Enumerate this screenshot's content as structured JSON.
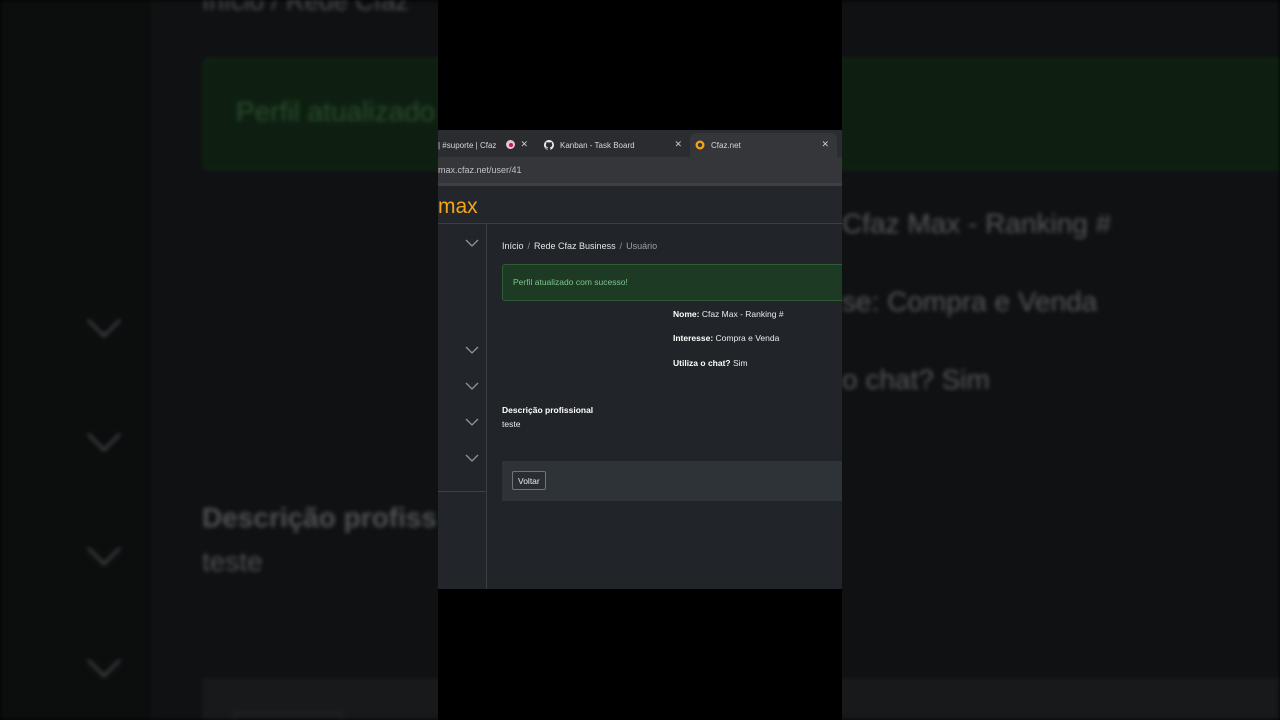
{
  "background": {
    "breadcrumb": "Início  /  Rede Cfaz",
    "alert": "Perfil atualizado",
    "nome": "Cfaz Max - Ranking #",
    "interesse": "se: Compra e Venda",
    "chat": "o chat? Sim",
    "descricao_label": "Descrição profiss",
    "descricao_value": "teste"
  },
  "browser": {
    "tabs": [
      {
        "label": "| #suporte | Cfaz",
        "icon": "slack-icon"
      },
      {
        "label": "Kanban - Task Board",
        "icon": "github-icon"
      },
      {
        "label": "Cfaz.net",
        "icon": "cfaz-icon",
        "active": true
      }
    ],
    "url": "max.cfaz.net/user/41"
  },
  "app": {
    "logo": "max",
    "breadcrumb": {
      "home": "Início",
      "section": "Rede Cfaz Business",
      "current": "Usuário"
    },
    "alert": "Perfil atualizado com sucesso!",
    "profile": {
      "nome_label": "Nome:",
      "nome_value": "Cfaz Max - Ranking #",
      "interesse_label": "Interesse:",
      "interesse_value": "Compra e Venda",
      "chat_label": "Utiliza o chat?",
      "chat_value": "Sim"
    },
    "descricao": {
      "label": "Descrição profissional",
      "value": "teste"
    },
    "buttons": {
      "back": "Voltar"
    }
  },
  "colors": {
    "accent": "#f6a41a",
    "success_bg": "#1d3a24",
    "success_text": "#7ec48b"
  }
}
